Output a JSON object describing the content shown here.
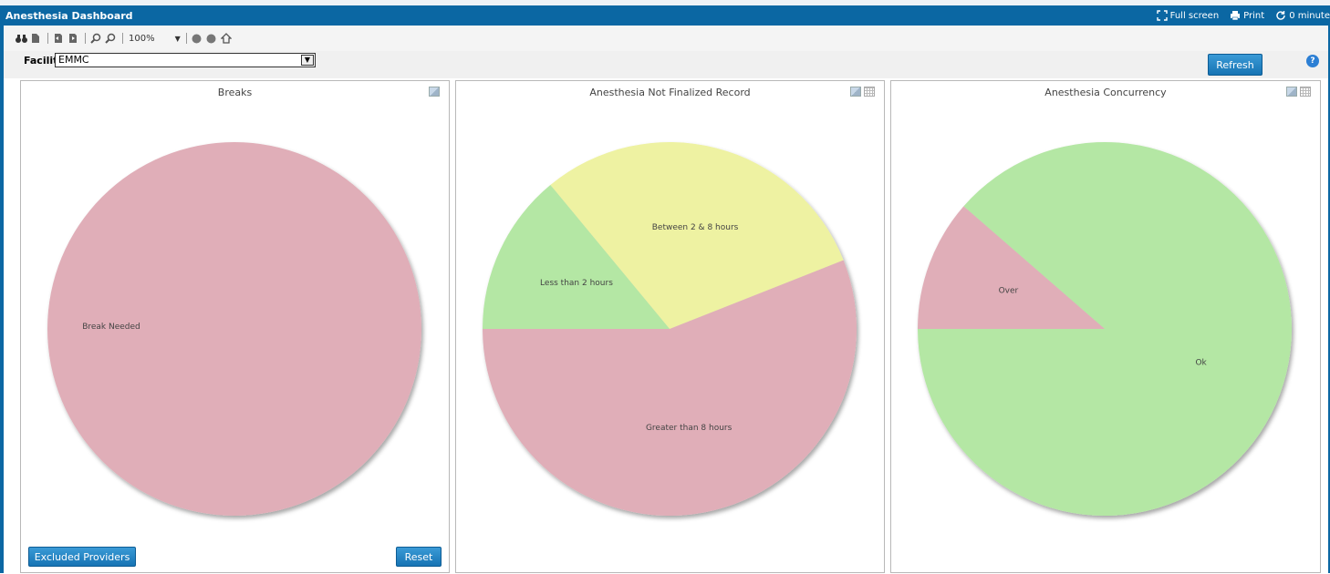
{
  "app": {
    "title": "Anesthesia Dashboard"
  },
  "titlebar": {
    "fullscreen_label": "Full screen",
    "print_label": "Print",
    "autorefresh_label": "0 minute"
  },
  "toolbar": {
    "zoom_value": "100%"
  },
  "filter": {
    "facility_label": "Facility",
    "facility_value": "EMMC",
    "refresh_label": "Refresh"
  },
  "colors": {
    "brand": "#0b67a3",
    "pink": "#e0aeb8",
    "yellow": "#eef2a2",
    "green": "#b4e7a4"
  },
  "panels": {
    "breaks": {
      "title": "Breaks",
      "excluded_label": "Excluded Providers",
      "reset_label": "Reset"
    },
    "not_finalized": {
      "title": "Anesthesia Not Finalized Record"
    },
    "concurrency": {
      "title": "Anesthesia Concurrency"
    }
  },
  "chart_data": [
    {
      "type": "pie",
      "title": "Breaks",
      "slices": [
        {
          "label": "Break Needed",
          "value": 100,
          "color": "#e0aeb8"
        }
      ]
    },
    {
      "type": "pie",
      "title": "Anesthesia Not Finalized Record",
      "slices": [
        {
          "label": "Greater than 8 hours",
          "value": 56,
          "color": "#e0aeb8"
        },
        {
          "label": "Between 2 & 8 hours",
          "value": 30,
          "color": "#eef2a2"
        },
        {
          "label": "Less than 2 hours",
          "value": 14,
          "color": "#b4e7a4"
        }
      ]
    },
    {
      "type": "pie",
      "title": "Anesthesia Concurrency",
      "slices": [
        {
          "label": "Ok",
          "value": 88.6,
          "color": "#b4e7a4"
        },
        {
          "label": "Over",
          "value": 11.4,
          "color": "#e0aeb8"
        }
      ]
    }
  ]
}
